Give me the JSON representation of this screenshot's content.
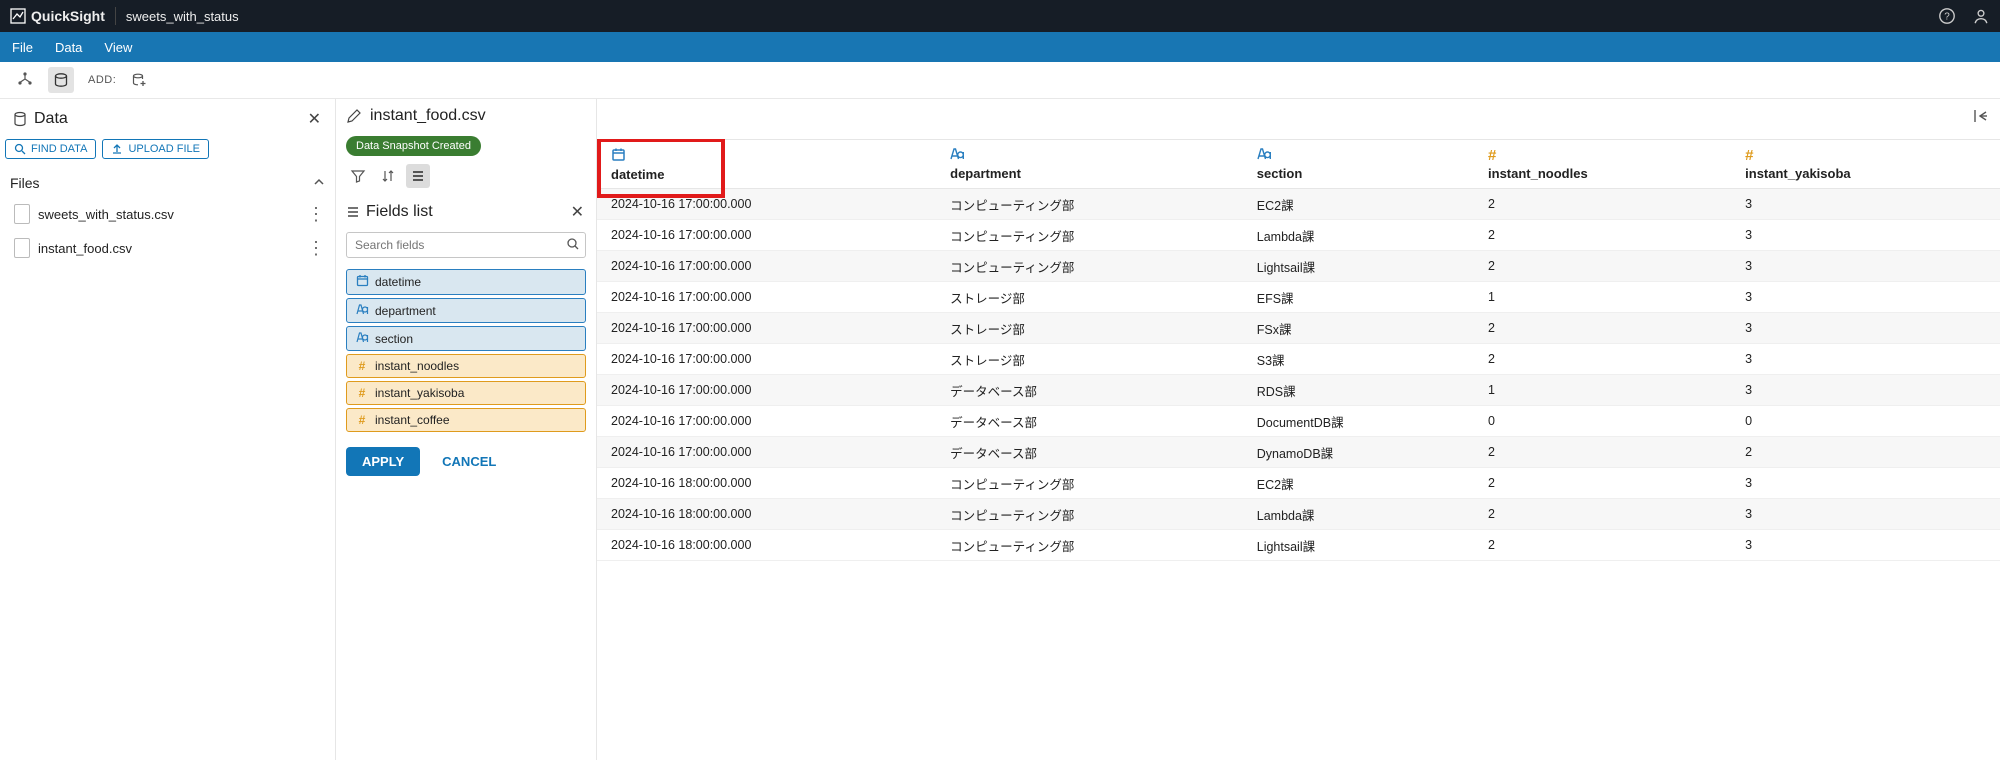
{
  "topbar": {
    "product": "QuickSight",
    "dataset": "sweets_with_status"
  },
  "menubar": {
    "file": "File",
    "data": "Data",
    "view": "View"
  },
  "toolbar": {
    "add": "ADD:"
  },
  "left": {
    "title": "Data",
    "find": "FIND DATA",
    "upload": "UPLOAD FILE",
    "filesHeader": "Files",
    "files": [
      {
        "name": "sweets_with_status.csv"
      },
      {
        "name": "instant_food.csv"
      }
    ]
  },
  "mid": {
    "filename": "instant_food.csv",
    "snapshot": "Data Snapshot Created",
    "fieldsTitle": "Fields list",
    "searchPlaceholder": "Search fields",
    "fields": [
      {
        "name": "datetime",
        "kind": "date",
        "style": "dim-blue"
      },
      {
        "name": "department",
        "kind": "str",
        "style": "dim-blue"
      },
      {
        "name": "section",
        "kind": "str",
        "style": "dim-blue"
      },
      {
        "name": "instant_noodles",
        "kind": "num",
        "style": "meas-orange"
      },
      {
        "name": "instant_yakisoba",
        "kind": "num",
        "style": "meas-orange"
      },
      {
        "name": "instant_coffee",
        "kind": "num",
        "style": "meas-orange"
      }
    ],
    "apply": "APPLY",
    "cancel": "CANCEL"
  },
  "table": {
    "columns": [
      {
        "name": "datetime",
        "kind": "date"
      },
      {
        "name": "department",
        "kind": "str"
      },
      {
        "name": "section",
        "kind": "str"
      },
      {
        "name": "instant_noodles",
        "kind": "num"
      },
      {
        "name": "instant_yakisoba",
        "kind": "num"
      }
    ],
    "rows": [
      [
        "2024-10-16 17:00:00.000",
        "コンピューティング部",
        "EC2課",
        "2",
        "3"
      ],
      [
        "2024-10-16 17:00:00.000",
        "コンピューティング部",
        "Lambda課",
        "2",
        "3"
      ],
      [
        "2024-10-16 17:00:00.000",
        "コンピューティング部",
        "Lightsail課",
        "2",
        "3"
      ],
      [
        "2024-10-16 17:00:00.000",
        "ストレージ部",
        "EFS課",
        "1",
        "3"
      ],
      [
        "2024-10-16 17:00:00.000",
        "ストレージ部",
        "FSx課",
        "2",
        "3"
      ],
      [
        "2024-10-16 17:00:00.000",
        "ストレージ部",
        "S3課",
        "2",
        "3"
      ],
      [
        "2024-10-16 17:00:00.000",
        "データベース部",
        "RDS課",
        "1",
        "3"
      ],
      [
        "2024-10-16 17:00:00.000",
        "データベース部",
        "DocumentDB課",
        "0",
        "0"
      ],
      [
        "2024-10-16 17:00:00.000",
        "データベース部",
        "DynamoDB課",
        "2",
        "2"
      ],
      [
        "2024-10-16 18:00:00.000",
        "コンピューティング部",
        "EC2課",
        "2",
        "3"
      ],
      [
        "2024-10-16 18:00:00.000",
        "コンピューティング部",
        "Lambda課",
        "2",
        "3"
      ],
      [
        "2024-10-16 18:00:00.000",
        "コンピューティング部",
        "Lightsail課",
        "2",
        "3"
      ]
    ]
  },
  "highlight": {
    "colIndex": 0
  }
}
